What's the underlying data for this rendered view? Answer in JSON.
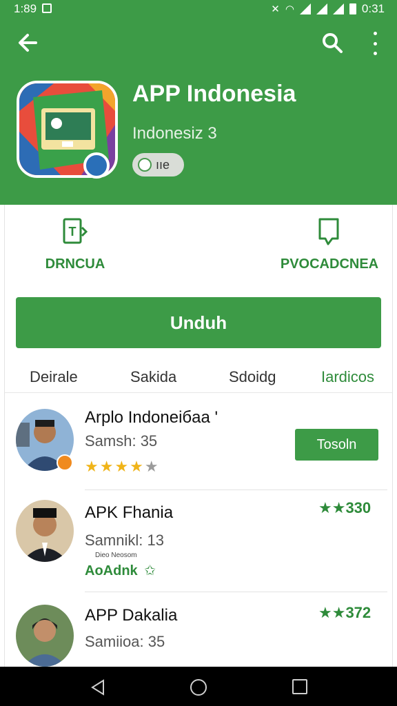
{
  "status_bar": {
    "time": "1:89",
    "battery_time": "0:31"
  },
  "app": {
    "title": "APP Indonesia",
    "developer": "Indonesiz 3",
    "chip_label": "ııe"
  },
  "actions": {
    "left_label": "DRNCUA",
    "right_label": "PVOCADCNEA"
  },
  "download_button_label": "Unduh",
  "tabs": [
    {
      "label": "Deirale"
    },
    {
      "label": "Sakida"
    },
    {
      "label": "Sdoidg"
    },
    {
      "label": "Iardicos"
    }
  ],
  "list": [
    {
      "title": "Arplo Indoneiбaa '",
      "subtitle": "Samsh: 35",
      "stars": "★★★★",
      "star_off": "★",
      "button": "Tosoln"
    },
    {
      "title": "APK Fhania",
      "subtitle": "Samnikl: 13",
      "note": "Dieo Neosom",
      "link": "AoAdnk",
      "rating": "★★330"
    },
    {
      "title": "APP Dakalia",
      "subtitle": "Samiioa: 35",
      "rating": "★★372"
    }
  ],
  "colors": {
    "primary_green": "#3d9b47",
    "accent_green": "#2e8b3a",
    "star_yellow": "#f0b419"
  }
}
